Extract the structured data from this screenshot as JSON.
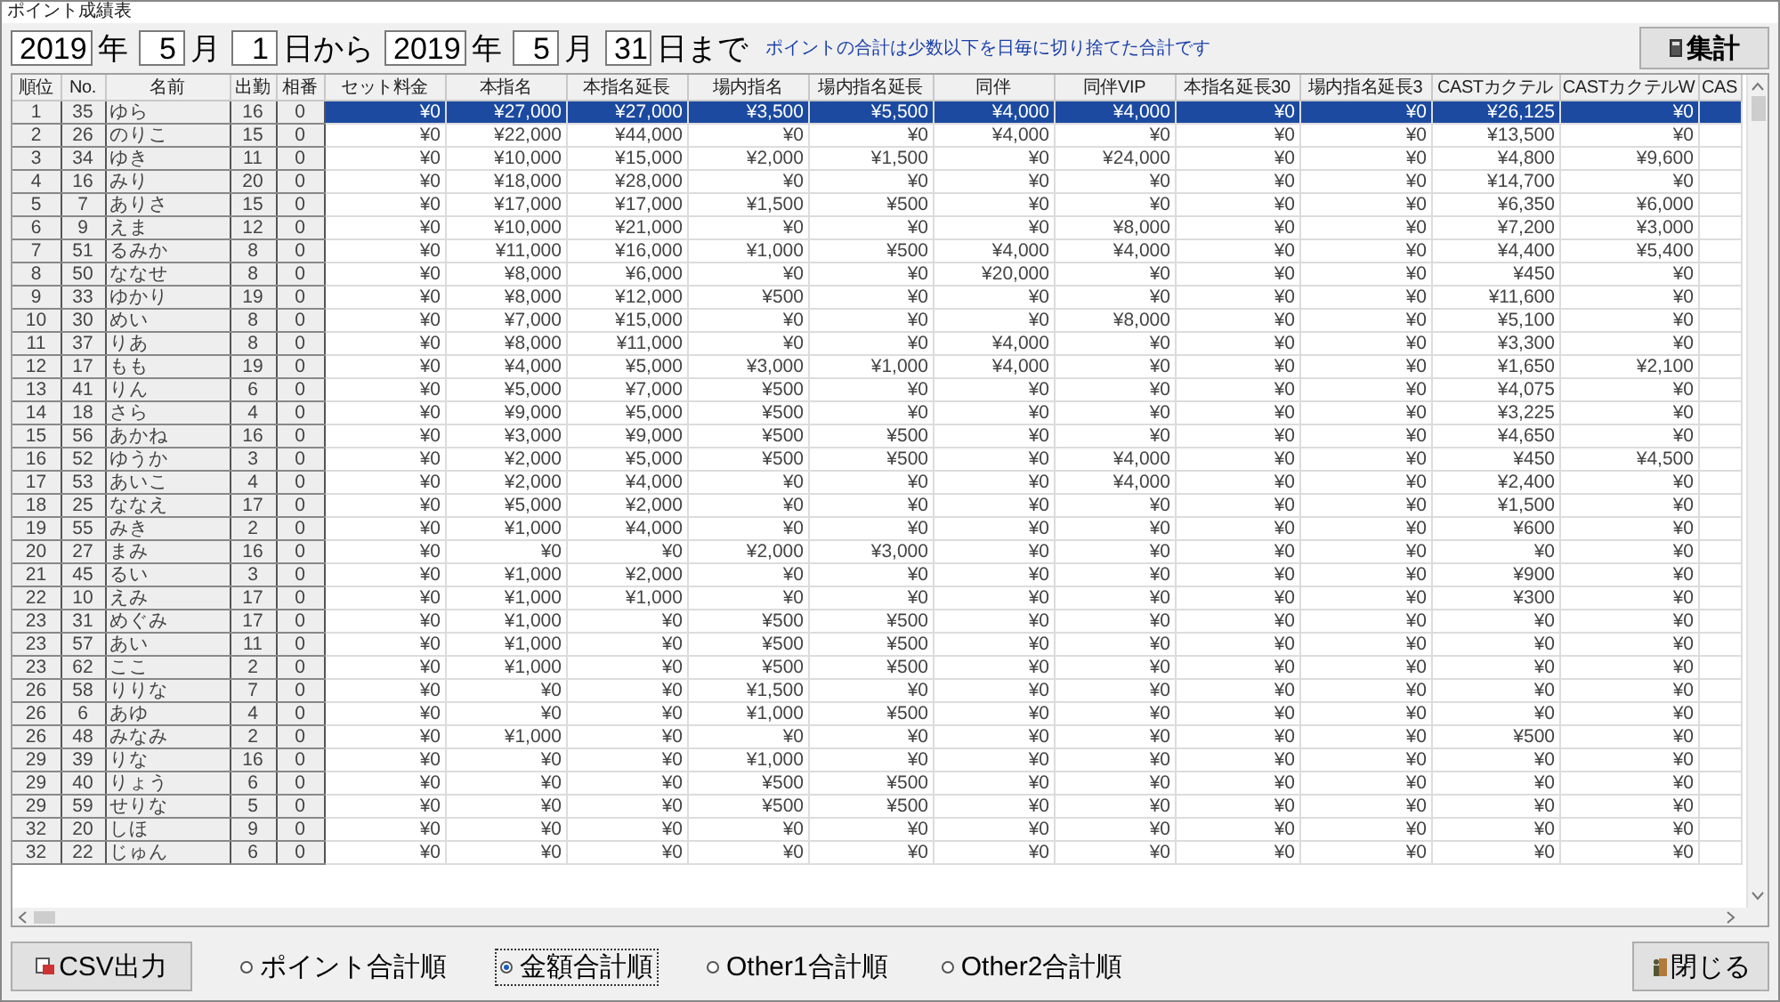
{
  "window": {
    "title": "ポイント成績表"
  },
  "date_range": [
    {
      "kind": "field",
      "value": "2019"
    },
    {
      "kind": "label",
      "text": "年"
    },
    {
      "kind": "field",
      "value": "5"
    },
    {
      "kind": "label",
      "text": "月"
    },
    {
      "kind": "field",
      "value": "1"
    },
    {
      "kind": "label",
      "text": "日から"
    },
    {
      "kind": "field",
      "value": "2019"
    },
    {
      "kind": "label",
      "text": "年"
    },
    {
      "kind": "field",
      "value": "5"
    },
    {
      "kind": "label",
      "text": "月"
    },
    {
      "kind": "field",
      "value": "31"
    },
    {
      "kind": "label",
      "text": "日まで"
    }
  ],
  "note": "ポイントの合計は少数以下を日毎に切り捨てた合計です",
  "total_button": "集計",
  "table": {
    "columns": [
      "順位",
      "No.",
      "名前",
      "出勤",
      "相番",
      "セット料金",
      "本指名",
      "本指名延長",
      "場内指名",
      "場内指名延長",
      "同伴",
      "同伴VIP",
      "本指名延長30",
      "場内指名延長3",
      "CASTカクテル",
      "CASTカクテルW",
      "CAS"
    ],
    "rows": [
      {
        "selected": true,
        "cells": [
          "1",
          "35",
          "ゆら",
          "16",
          "0",
          "¥0",
          "¥27,000",
          "¥27,000",
          "¥3,500",
          "¥5,500",
          "¥4,000",
          "¥4,000",
          "¥0",
          "¥0",
          "¥26,125",
          "¥0"
        ]
      },
      {
        "selected": false,
        "cells": [
          "2",
          "26",
          "のりこ",
          "15",
          "0",
          "¥0",
          "¥22,000",
          "¥44,000",
          "¥0",
          "¥0",
          "¥4,000",
          "¥0",
          "¥0",
          "¥0",
          "¥13,500",
          "¥0"
        ]
      },
      {
        "selected": false,
        "cells": [
          "3",
          "34",
          "ゆき",
          "11",
          "0",
          "¥0",
          "¥10,000",
          "¥15,000",
          "¥2,000",
          "¥1,500",
          "¥0",
          "¥24,000",
          "¥0",
          "¥0",
          "¥4,800",
          "¥9,600"
        ]
      },
      {
        "selected": false,
        "cells": [
          "4",
          "16",
          "みり",
          "20",
          "0",
          "¥0",
          "¥18,000",
          "¥28,000",
          "¥0",
          "¥0",
          "¥0",
          "¥0",
          "¥0",
          "¥0",
          "¥14,700",
          "¥0"
        ]
      },
      {
        "selected": false,
        "cells": [
          "5",
          "7",
          "ありさ",
          "15",
          "0",
          "¥0",
          "¥17,000",
          "¥17,000",
          "¥1,500",
          "¥500",
          "¥0",
          "¥0",
          "¥0",
          "¥0",
          "¥6,350",
          "¥6,000"
        ]
      },
      {
        "selected": false,
        "cells": [
          "6",
          "9",
          "えま",
          "12",
          "0",
          "¥0",
          "¥10,000",
          "¥21,000",
          "¥0",
          "¥0",
          "¥0",
          "¥8,000",
          "¥0",
          "¥0",
          "¥7,200",
          "¥3,000"
        ]
      },
      {
        "selected": false,
        "cells": [
          "7",
          "51",
          "るみか",
          "8",
          "0",
          "¥0",
          "¥11,000",
          "¥16,000",
          "¥1,000",
          "¥500",
          "¥4,000",
          "¥4,000",
          "¥0",
          "¥0",
          "¥4,400",
          "¥5,400"
        ]
      },
      {
        "selected": false,
        "cells": [
          "8",
          "50",
          "ななせ",
          "8",
          "0",
          "¥0",
          "¥8,000",
          "¥6,000",
          "¥0",
          "¥0",
          "¥20,000",
          "¥0",
          "¥0",
          "¥0",
          "¥450",
          "¥0"
        ]
      },
      {
        "selected": false,
        "cells": [
          "9",
          "33",
          "ゆかり",
          "19",
          "0",
          "¥0",
          "¥8,000",
          "¥12,000",
          "¥500",
          "¥0",
          "¥0",
          "¥0",
          "¥0",
          "¥0",
          "¥11,600",
          "¥0"
        ]
      },
      {
        "selected": false,
        "cells": [
          "10",
          "30",
          "めい",
          "8",
          "0",
          "¥0",
          "¥7,000",
          "¥15,000",
          "¥0",
          "¥0",
          "¥0",
          "¥8,000",
          "¥0",
          "¥0",
          "¥5,100",
          "¥0"
        ]
      },
      {
        "selected": false,
        "cells": [
          "11",
          "37",
          "りあ",
          "8",
          "0",
          "¥0",
          "¥8,000",
          "¥11,000",
          "¥0",
          "¥0",
          "¥4,000",
          "¥0",
          "¥0",
          "¥0",
          "¥3,300",
          "¥0"
        ]
      },
      {
        "selected": false,
        "cells": [
          "12",
          "17",
          "もも",
          "19",
          "0",
          "¥0",
          "¥4,000",
          "¥5,000",
          "¥3,000",
          "¥1,000",
          "¥4,000",
          "¥0",
          "¥0",
          "¥0",
          "¥1,650",
          "¥2,100"
        ]
      },
      {
        "selected": false,
        "cells": [
          "13",
          "41",
          "りん",
          "6",
          "0",
          "¥0",
          "¥5,000",
          "¥7,000",
          "¥500",
          "¥0",
          "¥0",
          "¥0",
          "¥0",
          "¥0",
          "¥4,075",
          "¥0"
        ]
      },
      {
        "selected": false,
        "cells": [
          "14",
          "18",
          "さら",
          "4",
          "0",
          "¥0",
          "¥9,000",
          "¥5,000",
          "¥500",
          "¥0",
          "¥0",
          "¥0",
          "¥0",
          "¥0",
          "¥3,225",
          "¥0"
        ]
      },
      {
        "selected": false,
        "cells": [
          "15",
          "56",
          "あかね",
          "16",
          "0",
          "¥0",
          "¥3,000",
          "¥9,000",
          "¥500",
          "¥500",
          "¥0",
          "¥0",
          "¥0",
          "¥0",
          "¥4,650",
          "¥0"
        ]
      },
      {
        "selected": false,
        "cells": [
          "16",
          "52",
          "ゆうか",
          "3",
          "0",
          "¥0",
          "¥2,000",
          "¥5,000",
          "¥500",
          "¥500",
          "¥0",
          "¥4,000",
          "¥0",
          "¥0",
          "¥450",
          "¥4,500"
        ]
      },
      {
        "selected": false,
        "cells": [
          "17",
          "53",
          "あいこ",
          "4",
          "0",
          "¥0",
          "¥2,000",
          "¥4,000",
          "¥0",
          "¥0",
          "¥0",
          "¥4,000",
          "¥0",
          "¥0",
          "¥2,400",
          "¥0"
        ]
      },
      {
        "selected": false,
        "cells": [
          "18",
          "25",
          "ななえ",
          "17",
          "0",
          "¥0",
          "¥5,000",
          "¥2,000",
          "¥0",
          "¥0",
          "¥0",
          "¥0",
          "¥0",
          "¥0",
          "¥1,500",
          "¥0"
        ]
      },
      {
        "selected": false,
        "cells": [
          "19",
          "55",
          "みき",
          "2",
          "0",
          "¥0",
          "¥1,000",
          "¥4,000",
          "¥0",
          "¥0",
          "¥0",
          "¥0",
          "¥0",
          "¥0",
          "¥600",
          "¥0"
        ]
      },
      {
        "selected": false,
        "cells": [
          "20",
          "27",
          "まみ",
          "16",
          "0",
          "¥0",
          "¥0",
          "¥0",
          "¥2,000",
          "¥3,000",
          "¥0",
          "¥0",
          "¥0",
          "¥0",
          "¥0",
          "¥0"
        ]
      },
      {
        "selected": false,
        "cells": [
          "21",
          "45",
          "るい",
          "3",
          "0",
          "¥0",
          "¥1,000",
          "¥2,000",
          "¥0",
          "¥0",
          "¥0",
          "¥0",
          "¥0",
          "¥0",
          "¥900",
          "¥0"
        ]
      },
      {
        "selected": false,
        "cells": [
          "22",
          "10",
          "えみ",
          "17",
          "0",
          "¥0",
          "¥1,000",
          "¥1,000",
          "¥0",
          "¥0",
          "¥0",
          "¥0",
          "¥0",
          "¥0",
          "¥300",
          "¥0"
        ]
      },
      {
        "selected": false,
        "cells": [
          "23",
          "31",
          "めぐみ",
          "17",
          "0",
          "¥0",
          "¥1,000",
          "¥0",
          "¥500",
          "¥500",
          "¥0",
          "¥0",
          "¥0",
          "¥0",
          "¥0",
          "¥0"
        ]
      },
      {
        "selected": false,
        "cells": [
          "23",
          "57",
          "あい",
          "11",
          "0",
          "¥0",
          "¥1,000",
          "¥0",
          "¥500",
          "¥500",
          "¥0",
          "¥0",
          "¥0",
          "¥0",
          "¥0",
          "¥0"
        ]
      },
      {
        "selected": false,
        "cells": [
          "23",
          "62",
          "ここ",
          "2",
          "0",
          "¥0",
          "¥1,000",
          "¥0",
          "¥500",
          "¥500",
          "¥0",
          "¥0",
          "¥0",
          "¥0",
          "¥0",
          "¥0"
        ]
      },
      {
        "selected": false,
        "cells": [
          "26",
          "58",
          "りりな",
          "7",
          "0",
          "¥0",
          "¥0",
          "¥0",
          "¥1,500",
          "¥0",
          "¥0",
          "¥0",
          "¥0",
          "¥0",
          "¥0",
          "¥0"
        ]
      },
      {
        "selected": false,
        "cells": [
          "26",
          "6",
          "あゆ",
          "4",
          "0",
          "¥0",
          "¥0",
          "¥0",
          "¥1,000",
          "¥500",
          "¥0",
          "¥0",
          "¥0",
          "¥0",
          "¥0",
          "¥0"
        ]
      },
      {
        "selected": false,
        "cells": [
          "26",
          "48",
          "みなみ",
          "2",
          "0",
          "¥0",
          "¥1,000",
          "¥0",
          "¥0",
          "¥0",
          "¥0",
          "¥0",
          "¥0",
          "¥0",
          "¥500",
          "¥0"
        ]
      },
      {
        "selected": false,
        "cells": [
          "29",
          "39",
          "りな",
          "16",
          "0",
          "¥0",
          "¥0",
          "¥0",
          "¥1,000",
          "¥0",
          "¥0",
          "¥0",
          "¥0",
          "¥0",
          "¥0",
          "¥0"
        ]
      },
      {
        "selected": false,
        "cells": [
          "29",
          "40",
          "りょう",
          "6",
          "0",
          "¥0",
          "¥0",
          "¥0",
          "¥500",
          "¥500",
          "¥0",
          "¥0",
          "¥0",
          "¥0",
          "¥0",
          "¥0"
        ]
      },
      {
        "selected": false,
        "cells": [
          "29",
          "59",
          "せりな",
          "5",
          "0",
          "¥0",
          "¥0",
          "¥0",
          "¥500",
          "¥500",
          "¥0",
          "¥0",
          "¥0",
          "¥0",
          "¥0",
          "¥0"
        ]
      },
      {
        "selected": false,
        "cells": [
          "32",
          "20",
          "しほ",
          "9",
          "0",
          "¥0",
          "¥0",
          "¥0",
          "¥0",
          "¥0",
          "¥0",
          "¥0",
          "¥0",
          "¥0",
          "¥0",
          "¥0"
        ]
      },
      {
        "selected": false,
        "cells": [
          "32",
          "22",
          "じゅん",
          "6",
          "0",
          "¥0",
          "¥0",
          "¥0",
          "¥0",
          "¥0",
          "¥0",
          "¥0",
          "¥0",
          "¥0",
          "¥0",
          "¥0"
        ]
      }
    ]
  },
  "csv_button": "CSV出力",
  "sort_options": [
    {
      "label": "ポイント合計順",
      "selected": false
    },
    {
      "label": "金額合計順",
      "selected": true
    },
    {
      "label": "Other1合計順",
      "selected": false
    },
    {
      "label": "Other2合計順",
      "selected": false
    }
  ],
  "close_button": "閉じる"
}
